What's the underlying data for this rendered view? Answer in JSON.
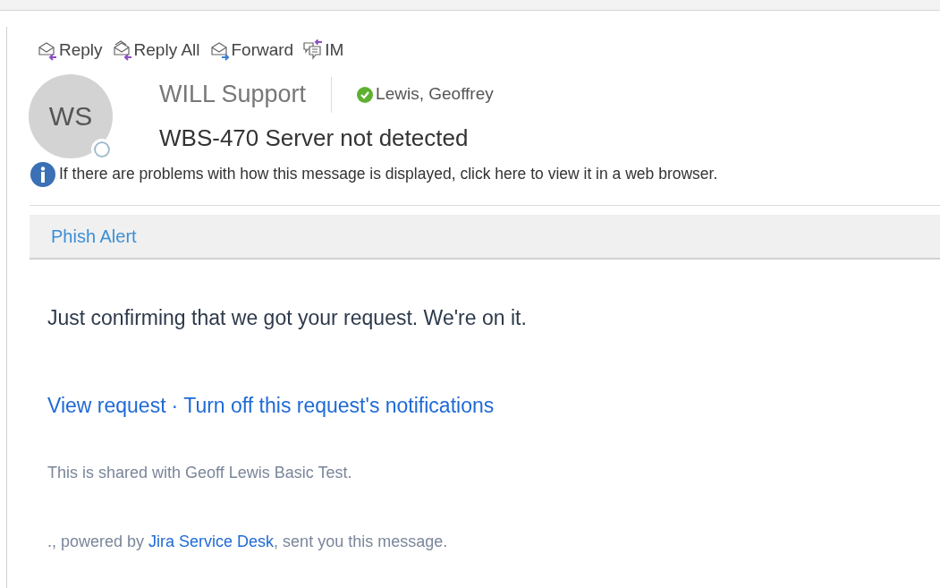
{
  "toolbar": [
    {
      "label": "Reply",
      "kind": "reply"
    },
    {
      "label": "Reply All",
      "kind": "reply_all"
    },
    {
      "label": "Forward",
      "kind": "forward"
    },
    {
      "label": "IM",
      "kind": "im"
    }
  ],
  "header": {
    "avatar": {
      "initials": "WS",
      "online": false
    },
    "sender": "WILL Support",
    "recipient": {
      "name": "Lewis, Geoffrey",
      "online": true
    },
    "subject": "WBS-470 Server not detected"
  },
  "info_bar": "If there are problems with how this message is displayed, click here to view it in a web browser.",
  "addin_bar": "Phish Alert",
  "body": {
    "message": "Just confirming that we got your request. We're on it.",
    "links": [
      {
        "label": "View request"
      },
      {
        "label": "Turn off this request's notifications"
      }
    ],
    "link_separator": "·",
    "shared_note": "This is shared with Geoff Lewis Basic Test.",
    "footer": {
      "before": "., powered by ",
      "link": "Jira Service Desk",
      "after": ", sent you this message."
    }
  }
}
